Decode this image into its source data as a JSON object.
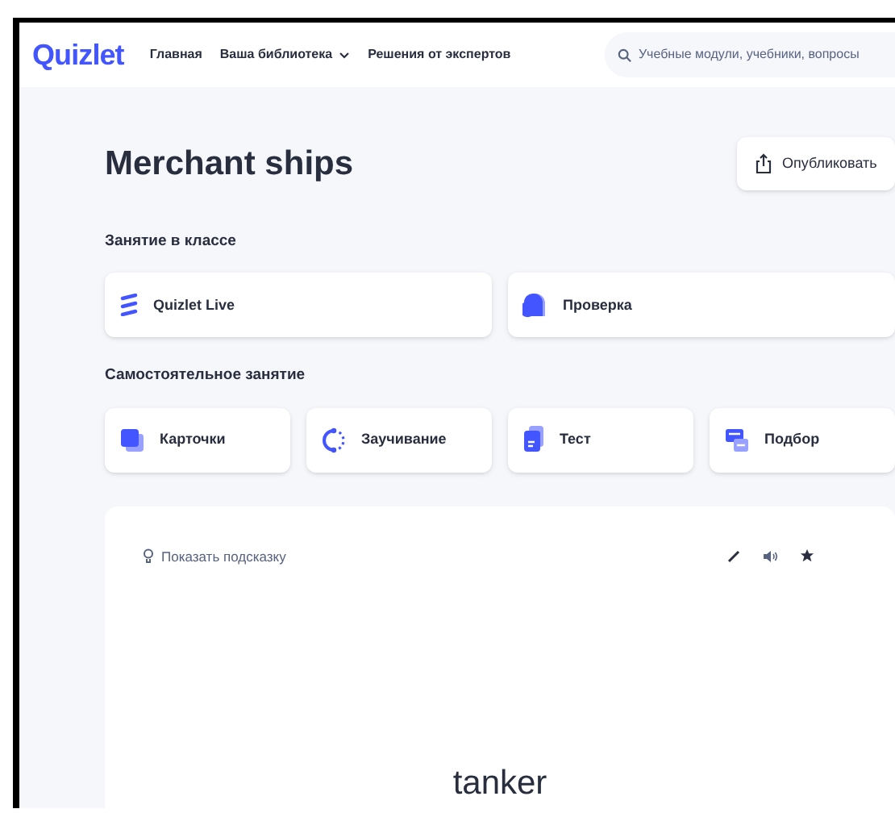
{
  "header": {
    "logo": "Quizlet",
    "nav": [
      {
        "label": "Главная",
        "dropdown": false
      },
      {
        "label": "Ваша библиотека",
        "dropdown": true
      },
      {
        "label": "Решения от экспертов",
        "dropdown": false
      }
    ],
    "search": {
      "placeholder": "Учебные модули, учебники, вопросы"
    }
  },
  "title": "Merchant ships",
  "publish_button": "Опубликовать",
  "sections": [
    {
      "heading": "Занятие в классе",
      "modes": [
        {
          "label": "Quizlet Live",
          "kind": "live"
        },
        {
          "label": "Проверка",
          "kind": "check"
        }
      ]
    },
    {
      "heading": "Самостоятельное занятие",
      "modes": [
        {
          "label": "Карточки",
          "kind": "cards"
        },
        {
          "label": "Заучивание",
          "kind": "learn"
        },
        {
          "label": "Тест",
          "kind": "test"
        },
        {
          "label": "Подбор",
          "kind": "match"
        }
      ]
    }
  ],
  "flashcard": {
    "hint": "Показать подсказку",
    "term": "tanker"
  }
}
